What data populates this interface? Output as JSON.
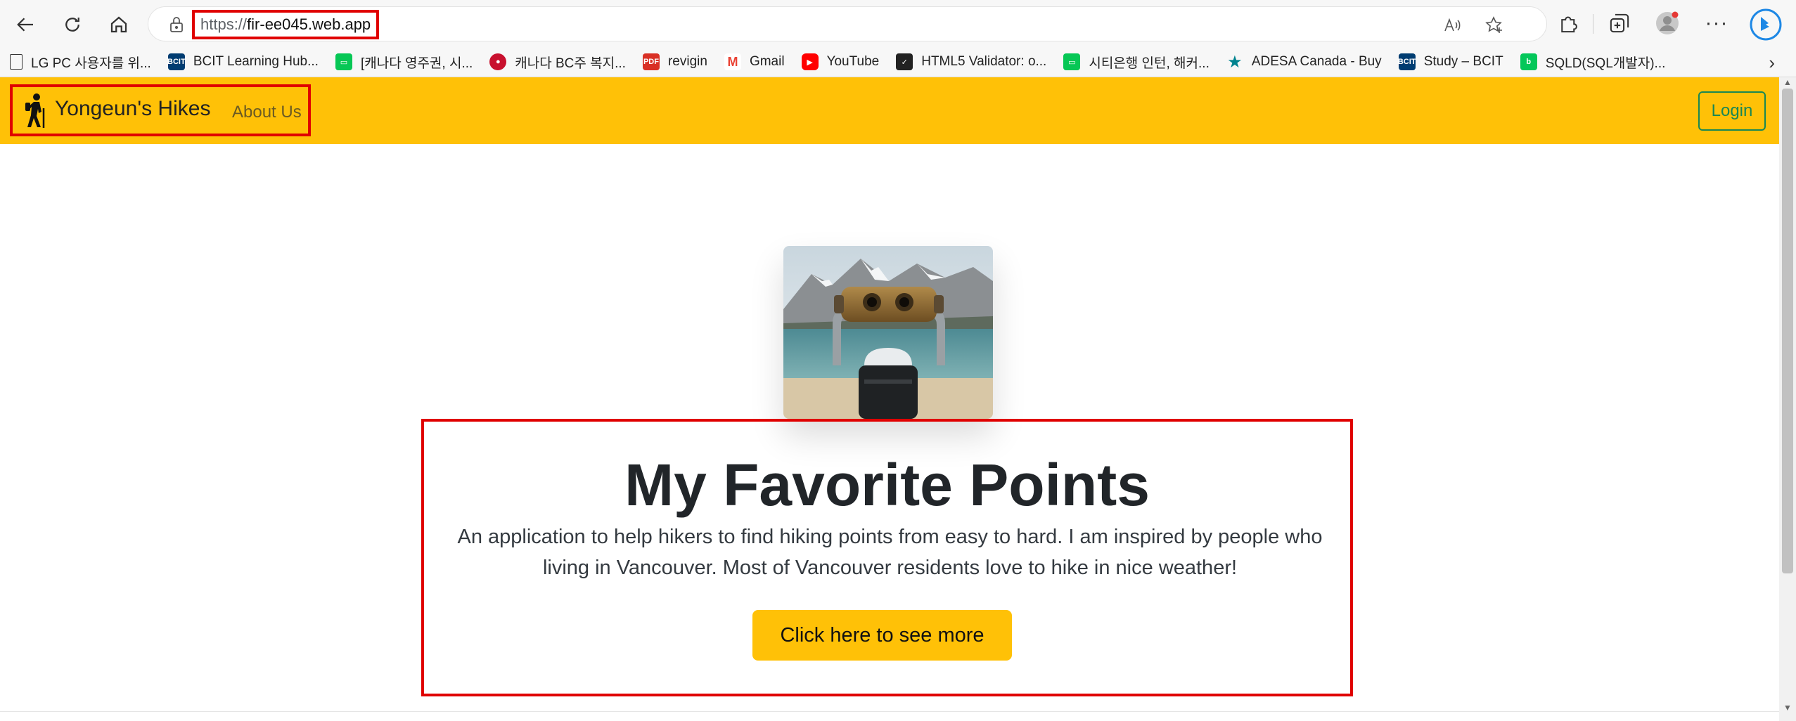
{
  "browser": {
    "url_protocol": "https://",
    "url_host": "fir-ee045.web.app",
    "bookmarks": [
      {
        "label": "LG PC 사용자를 위...",
        "icon": "page-icon",
        "color": "#ffffff"
      },
      {
        "label": "BCIT Learning Hub...",
        "icon": "bcit-icon",
        "color": "#003c71"
      },
      {
        "label": "[캐나다 영주권, 시...",
        "icon": "line-icon",
        "color": "#06c755"
      },
      {
        "label": "캐나다 BC주 복지...",
        "icon": "red-circle-icon",
        "color": "#c8102e"
      },
      {
        "label": "revigin",
        "icon": "pdf-icon",
        "color": "#d93025"
      },
      {
        "label": "Gmail",
        "icon": "gmail-icon",
        "color": "#ea4335"
      },
      {
        "label": "YouTube",
        "icon": "youtube-icon",
        "color": "#ff0000"
      },
      {
        "label": "HTML5 Validator: o...",
        "icon": "validator-icon",
        "color": "#222222"
      },
      {
        "label": "시티은행 인턴, 해커...",
        "icon": "line-icon",
        "color": "#06c755"
      },
      {
        "label": "ADESA Canada - Buy",
        "icon": "star-icon",
        "color": "#00838f"
      },
      {
        "label": "Study – BCIT",
        "icon": "bcit-icon",
        "color": "#003c71"
      },
      {
        "label": "SQLD(SQL개발자)...",
        "icon": "blog-icon",
        "color": "#03c75a"
      }
    ]
  },
  "navbar": {
    "brand": "Yongeun's Hikes",
    "about": "About Us",
    "login": "Login",
    "bg_color": "#ffc107"
  },
  "hero": {
    "title": "My Favorite Points",
    "lead": "An application to help hikers to find hiking points from easy to hard. I am inspired by people who living in Vancouver. Most of Vancouver residents love to hike in nice weather!",
    "cta": "Click here to see more"
  },
  "annotation_color": "#e00000"
}
